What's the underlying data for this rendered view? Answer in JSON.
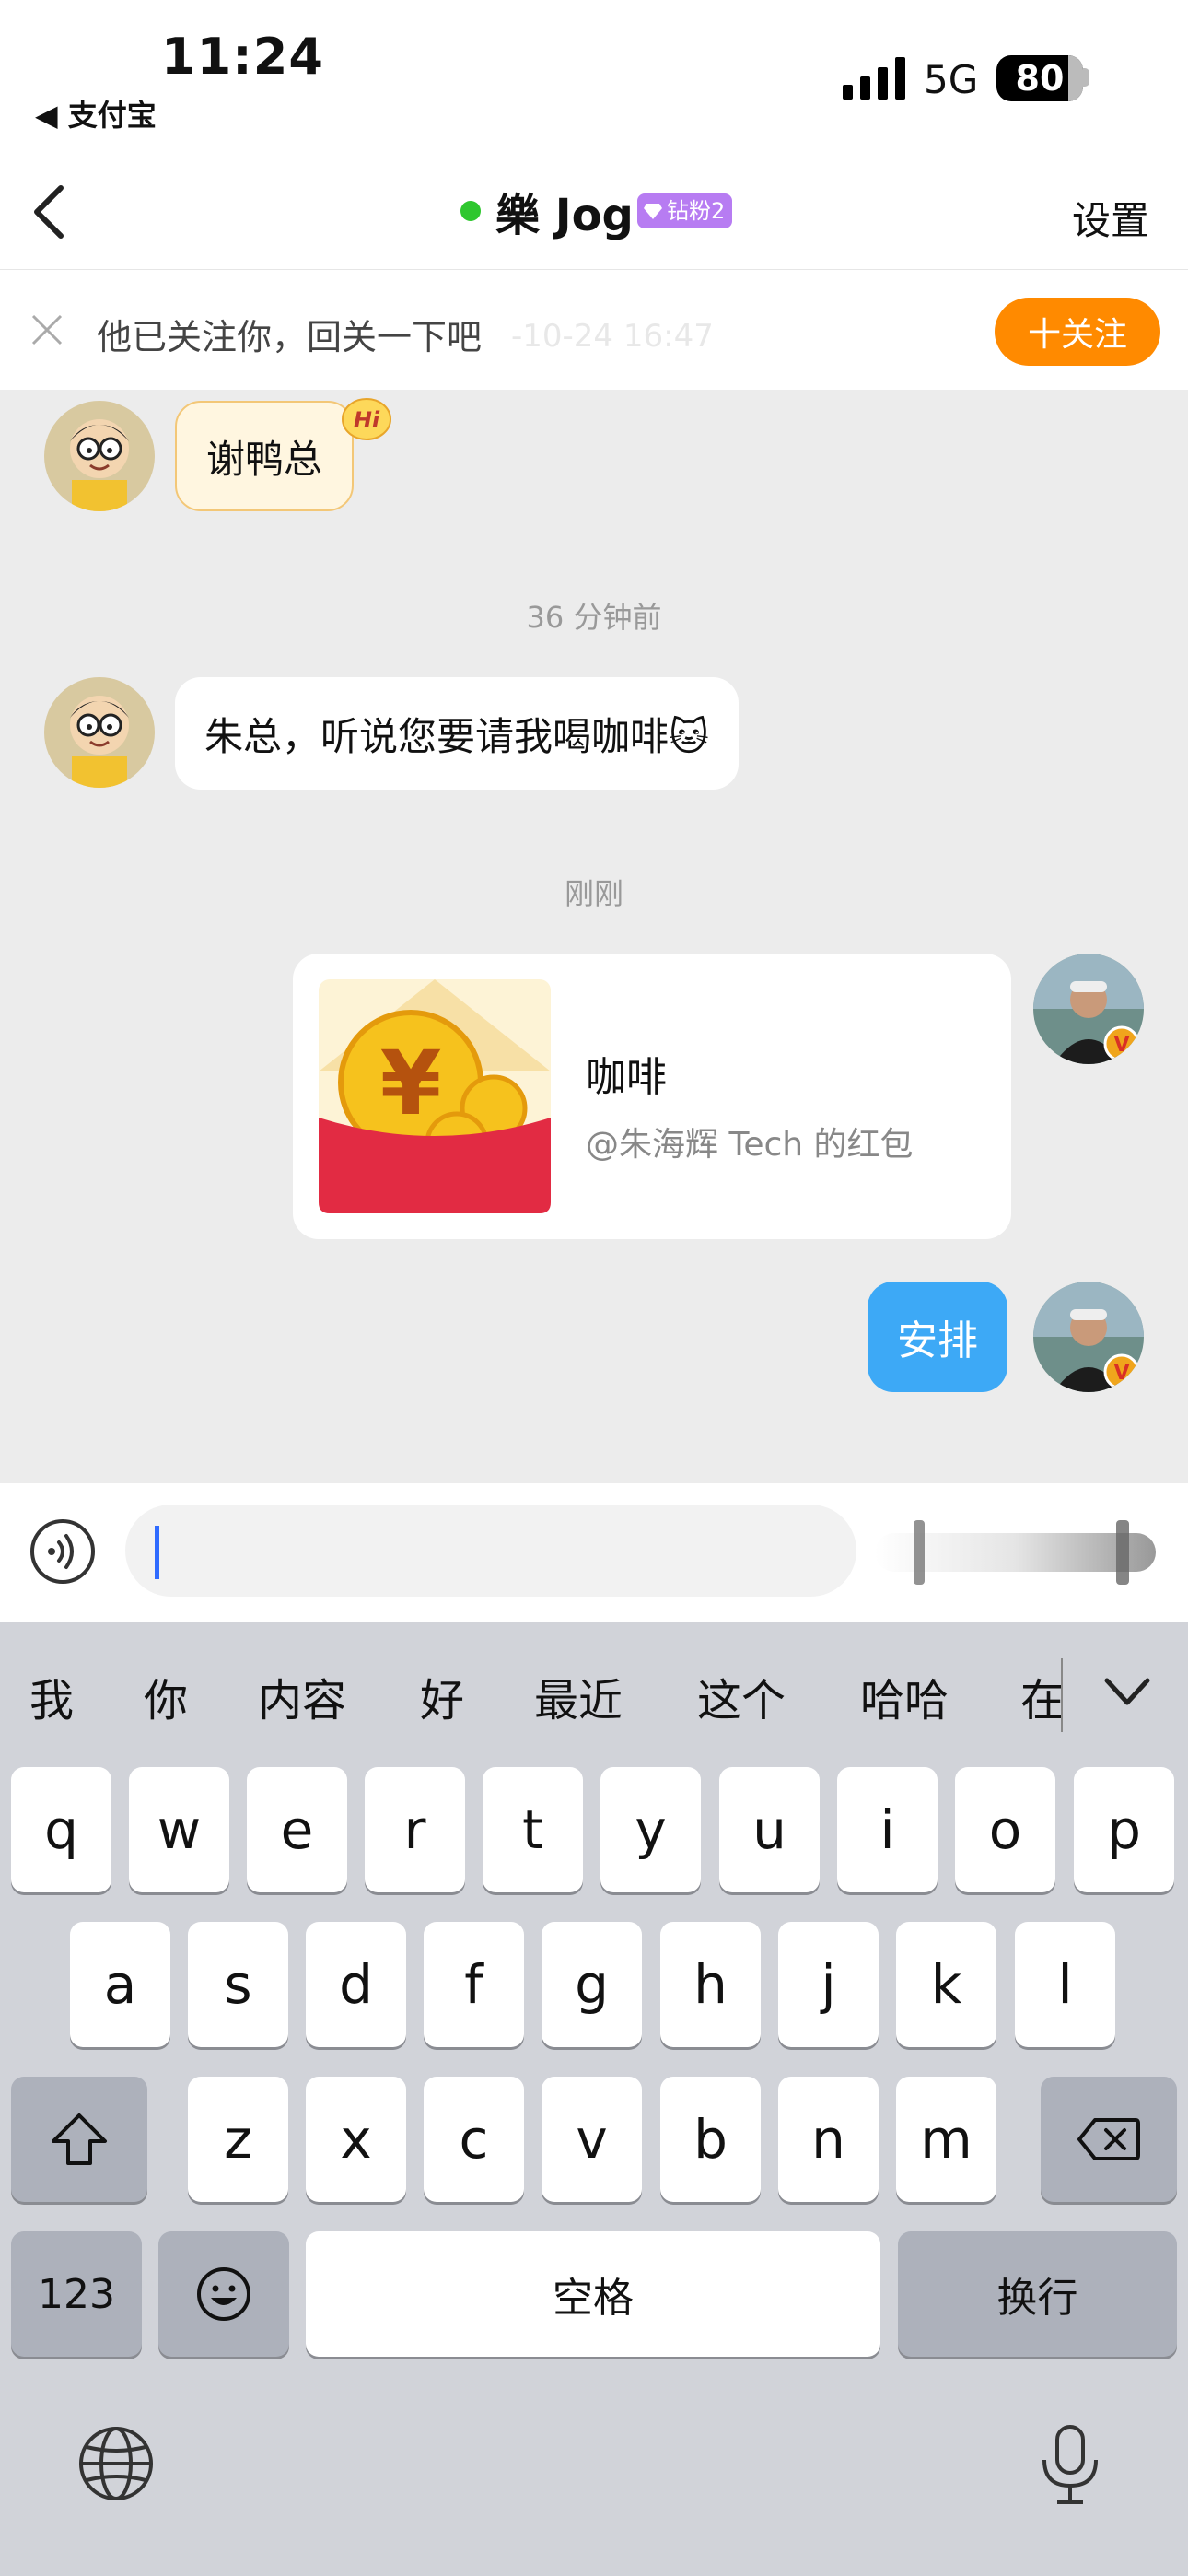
{
  "status_bar": {
    "time": "11:24",
    "back_app": "◀ 支付宝",
    "network": "5G",
    "battery": "80"
  },
  "nav": {
    "title": "樂 Jog",
    "badge": "钻粉2",
    "settings": "设置"
  },
  "follow_bar": {
    "text": "他已关注你，回关一下吧",
    "ghost_text": "-10-24 16:47",
    "button": "十关注"
  },
  "chat": {
    "messages": [
      {
        "side": "left",
        "text": "谢鸭总"
      },
      {
        "side": "left",
        "text": "朱总，听说您要请我喝咖啡🐱"
      },
      {
        "side": "right",
        "type": "red-packet",
        "title": "咖啡",
        "subtitle": "@朱海辉 Tech 的红包"
      },
      {
        "side": "right",
        "text": "安排"
      }
    ],
    "timestamps": [
      "36 分钟前",
      "刚刚"
    ],
    "hi_sticker": "Hi"
  },
  "input": {
    "value": "",
    "placeholder": ""
  },
  "keyboard": {
    "candidates": [
      "我",
      "你",
      "内容",
      "好",
      "最近",
      "这个",
      "哈哈",
      "在"
    ],
    "row1": [
      "q",
      "w",
      "e",
      "r",
      "t",
      "y",
      "u",
      "i",
      "o",
      "p"
    ],
    "row2": [
      "a",
      "s",
      "d",
      "f",
      "g",
      "h",
      "j",
      "k",
      "l"
    ],
    "row3": [
      "z",
      "x",
      "c",
      "v",
      "b",
      "n",
      "m"
    ],
    "key_123": "123",
    "space": "空格",
    "return": "换行"
  },
  "colors": {
    "accent_orange": "#ff8a00",
    "online_green": "#2ec72e",
    "bubble_blue": "#3da9f6",
    "badge_purple": "#b77cf2"
  }
}
